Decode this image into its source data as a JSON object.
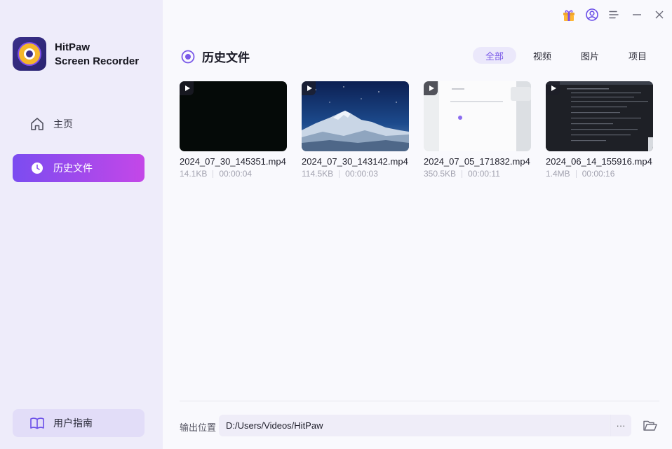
{
  "app": {
    "brand_line1": "HitPaw",
    "brand_line2": "Screen Recorder"
  },
  "sidebar": {
    "items": [
      {
        "label": "主页",
        "icon": "home-icon"
      },
      {
        "label": "历史文件",
        "icon": "clock-icon",
        "active": true
      }
    ],
    "guide_label": "用户指南",
    "guide_icon": "book-icon"
  },
  "titlebar": {
    "icons": [
      "gift-icon",
      "account-icon",
      "menu-icon",
      "minimize-icon",
      "close-icon"
    ]
  },
  "main": {
    "title": "历史文件",
    "tabs": [
      {
        "label": "全部",
        "active": true
      },
      {
        "label": "视频"
      },
      {
        "label": "图片"
      },
      {
        "label": "项目"
      }
    ],
    "files": [
      {
        "name": "2024_07_30_145351.mp4",
        "size": "14.1KB",
        "duration": "00:00:04"
      },
      {
        "name": "2024_07_30_143142.mp4",
        "size": "114.5KB",
        "duration": "00:00:03"
      },
      {
        "name": "2024_07_05_171832.mp4",
        "size": "350.5KB",
        "duration": "00:00:11"
      },
      {
        "name": "2024_06_14_155916.mp4",
        "size": "1.4MB",
        "duration": "00:00:16"
      }
    ]
  },
  "footer": {
    "output_label": "输出位置",
    "output_path": "D:/Users/Videos/HitPaw",
    "more_label": "···"
  },
  "colors": {
    "accent": "#7b4cf0",
    "accent_end": "#c447e8",
    "sidebar_bg": "#eeecfa"
  }
}
